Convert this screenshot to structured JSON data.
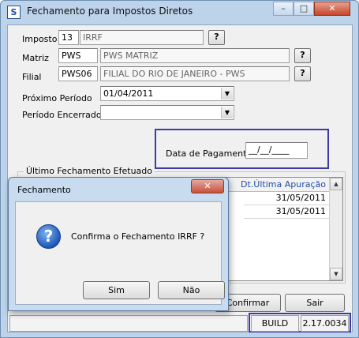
{
  "window": {
    "title": "Fechamento para Impostos Diretos",
    "icon": "app-logo-icon",
    "controls": {
      "minimize": "–",
      "maximize": "□",
      "close": "✕"
    }
  },
  "form": {
    "imposto": {
      "label": "Imposto",
      "code": "13",
      "description": "IRRF"
    },
    "matriz": {
      "label": "Matriz",
      "code": "PWS",
      "description": "PWS MATRIZ"
    },
    "filial": {
      "label": "Filial",
      "code": "PWS06",
      "description": "FILIAL DO RIO DE JANEIRO - PWS"
    },
    "proximo_periodo": {
      "label": "Próximo Período",
      "value": "01/04/2011"
    },
    "periodo_encerrado": {
      "label": "Período Encerrado",
      "value": ""
    },
    "lookup_label": "?",
    "data_pagamento": {
      "label": "Data de Pagamento",
      "value": "__/__/____"
    }
  },
  "grid": {
    "group_title": "Último Fechamento Efetuado",
    "column_header": "Dt.Última Apuração",
    "rows": [
      {
        "value": "31/05/2011"
      },
      {
        "value": "31/05/2011"
      }
    ]
  },
  "buttons": {
    "confirmar": "Confirmar",
    "sair": "Sair"
  },
  "status": {
    "build_label": "BUILD",
    "build_value": "2.17.0034"
  },
  "dialog": {
    "title": "Fechamento",
    "close": "✕",
    "message": "Confirma o Fechamento IRRF ?",
    "icon": "question-icon",
    "yes": "Sim",
    "no": "Não"
  },
  "colors": {
    "highlight": "#3a3aa8",
    "header_text": "#1f4ea8"
  }
}
